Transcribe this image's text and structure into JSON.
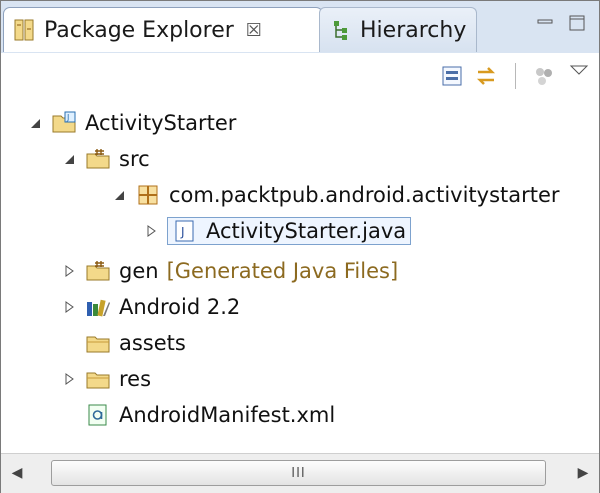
{
  "tabs": [
    {
      "label": "Package Explorer",
      "close": "☒",
      "icon": "package-explorer-icon",
      "active": true
    },
    {
      "label": "Hierarchy",
      "icon": "hierarchy-icon",
      "active": false
    }
  ],
  "toolbar": {
    "buttons": [
      "collapse-all-icon",
      "link-with-editor-icon",
      "filters-icon",
      "view-menu-icon"
    ]
  },
  "tree": {
    "project": {
      "label": "ActivityStarter",
      "icon": "java-project-icon"
    },
    "src": {
      "label": "src",
      "icon": "source-folder-icon"
    },
    "package": {
      "label": "com.packtpub.android.activitystarter",
      "icon": "package-icon"
    },
    "java_file": {
      "label": "ActivityStarter.java",
      "icon": "java-file-icon"
    },
    "gen": {
      "label": "gen",
      "decoration": "[Generated Java Files]",
      "icon": "source-folder-icon"
    },
    "android": {
      "label": "Android 2.2",
      "icon": "library-icon"
    },
    "assets": {
      "label": "assets",
      "icon": "folder-icon"
    },
    "res": {
      "label": "res",
      "icon": "folder-icon"
    },
    "manifest": {
      "label": "AndroidManifest.xml",
      "icon": "xml-file-icon"
    }
  },
  "scrollbar": {
    "thumb_grip": "III"
  }
}
